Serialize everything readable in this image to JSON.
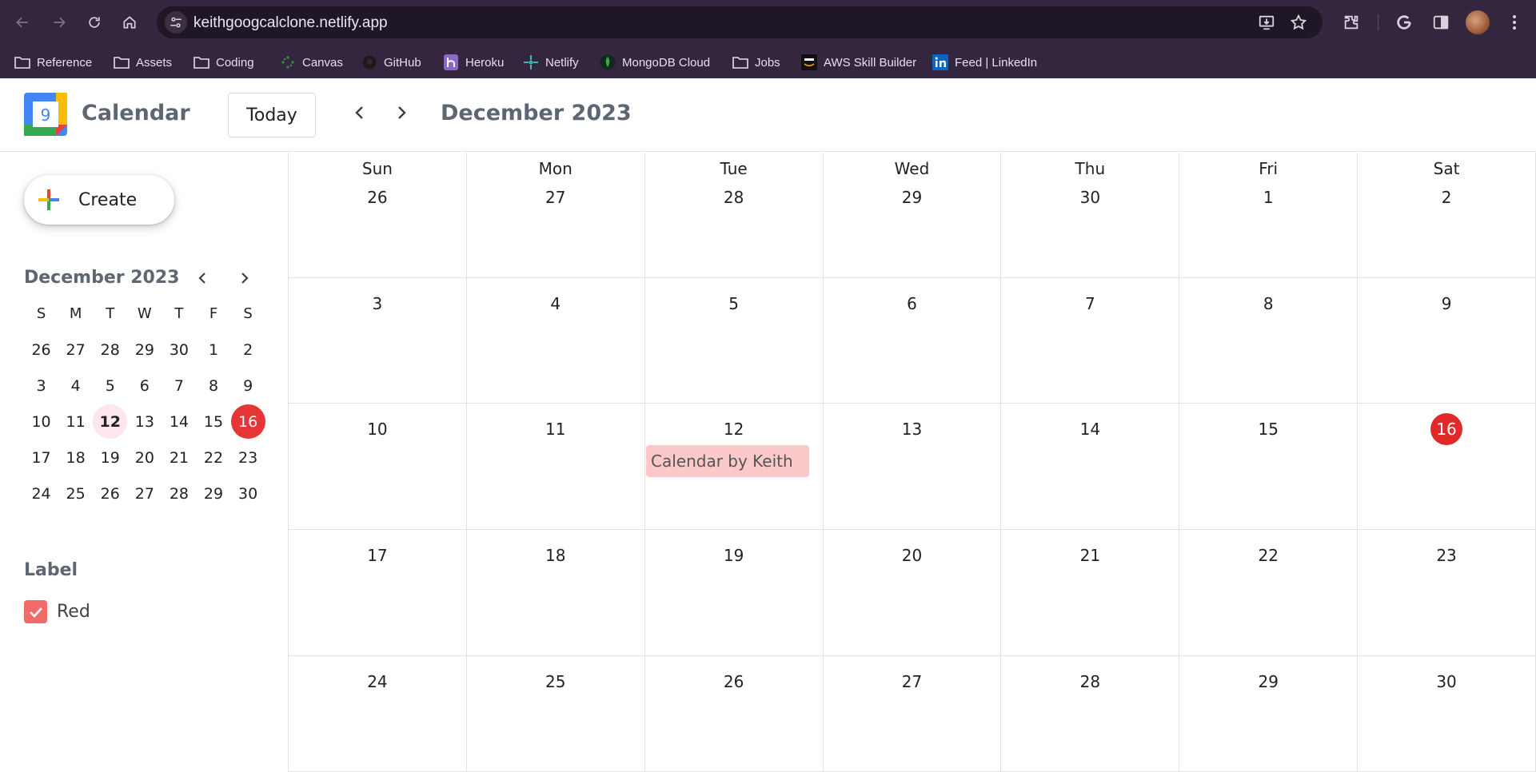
{
  "browser": {
    "url": "keithgoogcalclone.netlify.app",
    "bookmarks": [
      {
        "label": "Reference",
        "icon": "folder-icon"
      },
      {
        "label": "Assets",
        "icon": "folder-icon"
      },
      {
        "label": "Coding",
        "icon": "folder-icon"
      },
      {
        "label": "Canvas",
        "icon": "canvas-icon"
      },
      {
        "label": "GitHub",
        "icon": "github-icon"
      },
      {
        "label": "Heroku",
        "icon": "heroku-icon"
      },
      {
        "label": "Netlify",
        "icon": "netlify-icon"
      },
      {
        "label": "MongoDB Cloud",
        "icon": "mongodb-icon"
      },
      {
        "label": "Jobs",
        "icon": "folder-icon"
      },
      {
        "label": "AWS Skill Builder",
        "icon": "aws-icon"
      },
      {
        "label": "Feed | LinkedIn",
        "icon": "linkedin-icon"
      }
    ]
  },
  "header": {
    "app_title": "Calendar",
    "logo_number": "9",
    "today_label": "Today",
    "month_title": "December 2023"
  },
  "sidebar": {
    "create_label": "Create",
    "mini_calendar": {
      "title": "December 2023",
      "weekdays": [
        "S",
        "M",
        "T",
        "W",
        "T",
        "F",
        "S"
      ],
      "weeks": [
        [
          "26",
          "27",
          "28",
          "29",
          "30",
          "1",
          "2"
        ],
        [
          "3",
          "4",
          "5",
          "6",
          "7",
          "8",
          "9"
        ],
        [
          "10",
          "11",
          "12",
          "13",
          "14",
          "15",
          "16"
        ],
        [
          "17",
          "18",
          "19",
          "20",
          "21",
          "22",
          "23"
        ],
        [
          "24",
          "25",
          "26",
          "27",
          "28",
          "29",
          "30"
        ]
      ],
      "today": "12",
      "selected": "16"
    },
    "label_heading": "Label",
    "labels": [
      {
        "name": "Red",
        "checked": true,
        "color": "#f26b6b"
      }
    ]
  },
  "month": {
    "weekdays": [
      "Sun",
      "Mon",
      "Tue",
      "Wed",
      "Thu",
      "Fri",
      "Sat"
    ],
    "weeks": [
      [
        "26",
        "27",
        "28",
        "29",
        "30",
        "1",
        "2"
      ],
      [
        "3",
        "4",
        "5",
        "6",
        "7",
        "8",
        "9"
      ],
      [
        "10",
        "11",
        "12",
        "13",
        "14",
        "15",
        "16"
      ],
      [
        "17",
        "18",
        "19",
        "20",
        "21",
        "22",
        "23"
      ],
      [
        "24",
        "25",
        "26",
        "27",
        "28",
        "29",
        "30"
      ]
    ],
    "selected_day": "16",
    "events": [
      {
        "title": "Calendar by Keith",
        "day": "12",
        "color": "#fbc9c9"
      }
    ]
  },
  "colors": {
    "chrome_bg": "#35263f",
    "accent_red": "#e02a2a",
    "event_bg": "#fbc9c9",
    "title_gray": "#5f6673"
  }
}
